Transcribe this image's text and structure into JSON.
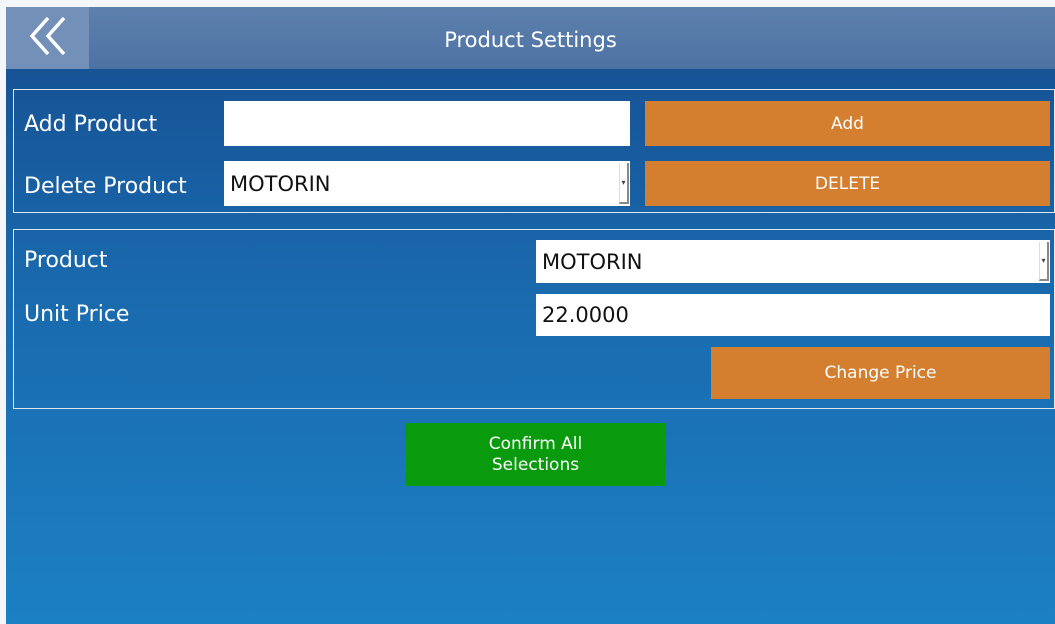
{
  "header": {
    "title": "Product Settings",
    "back_icon": "double-chevron-left-icon"
  },
  "add_section": {
    "add_label": "Add Product",
    "add_input_value": "",
    "add_button": "Add",
    "delete_label": "Delete Product",
    "delete_selected": "MOTORIN",
    "delete_button": "DELETE"
  },
  "price_section": {
    "product_label": "Product",
    "product_selected": "MOTORIN",
    "unit_price_label": "Unit Price",
    "unit_price_value": "22.0000",
    "change_price_button": "Change Price"
  },
  "confirm_button": "Confirm All\nSelections",
  "colors": {
    "header": "#4e73a3",
    "background": "#1a69ad",
    "orange_button": "#d47f30",
    "green_button": "#0a9a0d"
  }
}
